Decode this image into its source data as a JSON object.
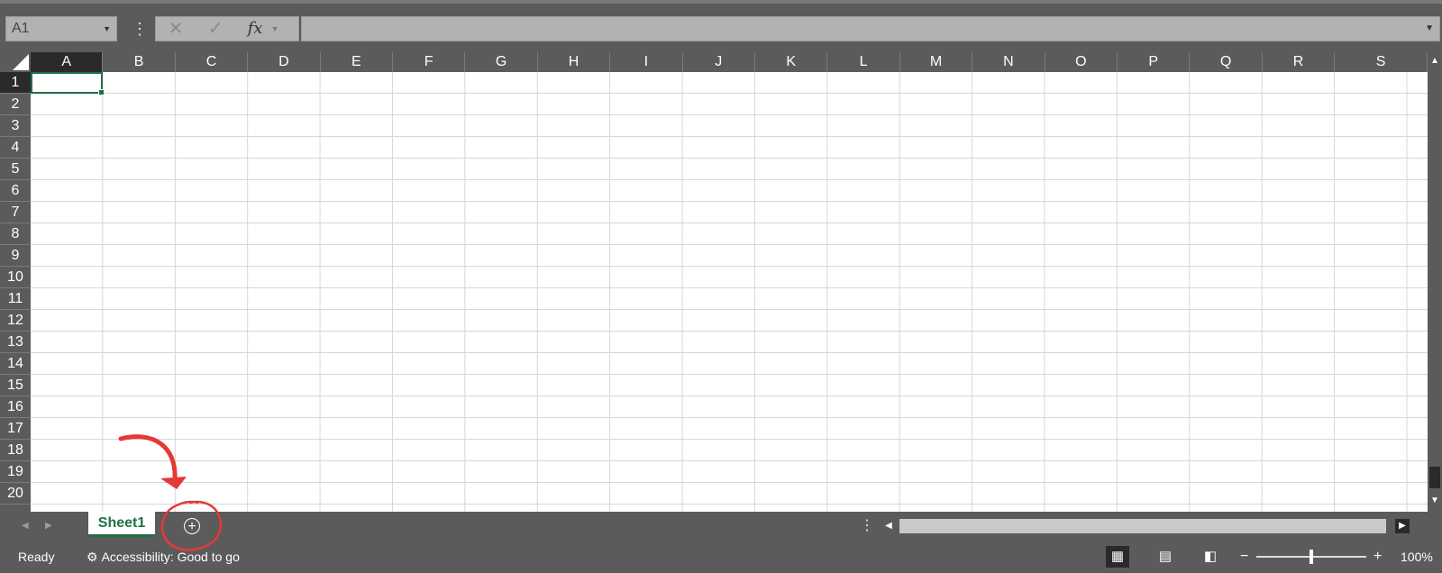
{
  "name_box": {
    "value": "A1"
  },
  "formula_bar": {
    "cancel_icon": "✕",
    "enter_icon": "✓",
    "fx_label": "fx",
    "input_value": ""
  },
  "columns": [
    "A",
    "B",
    "C",
    "D",
    "E",
    "F",
    "G",
    "H",
    "I",
    "J",
    "K",
    "L",
    "M",
    "N",
    "O",
    "P",
    "Q",
    "R",
    "S"
  ],
  "rows": [
    "1",
    "2",
    "3",
    "4",
    "5",
    "6",
    "7",
    "8",
    "9",
    "10",
    "11",
    "12",
    "13",
    "14",
    "15",
    "16",
    "17",
    "18",
    "19",
    "20"
  ],
  "selected_cell": "A1",
  "sheet_tabs": [
    {
      "label": "Sheet1",
      "active": true
    }
  ],
  "add_sheet_icon": "⊕",
  "status": {
    "ready": "Ready",
    "accessibility": "Accessibility: Good to go"
  },
  "zoom": {
    "level": "100%",
    "minus": "−",
    "plus": "+"
  },
  "colors": {
    "accent": "#1e7145",
    "annotation": "#e53935",
    "background": "#5b5b5b"
  }
}
